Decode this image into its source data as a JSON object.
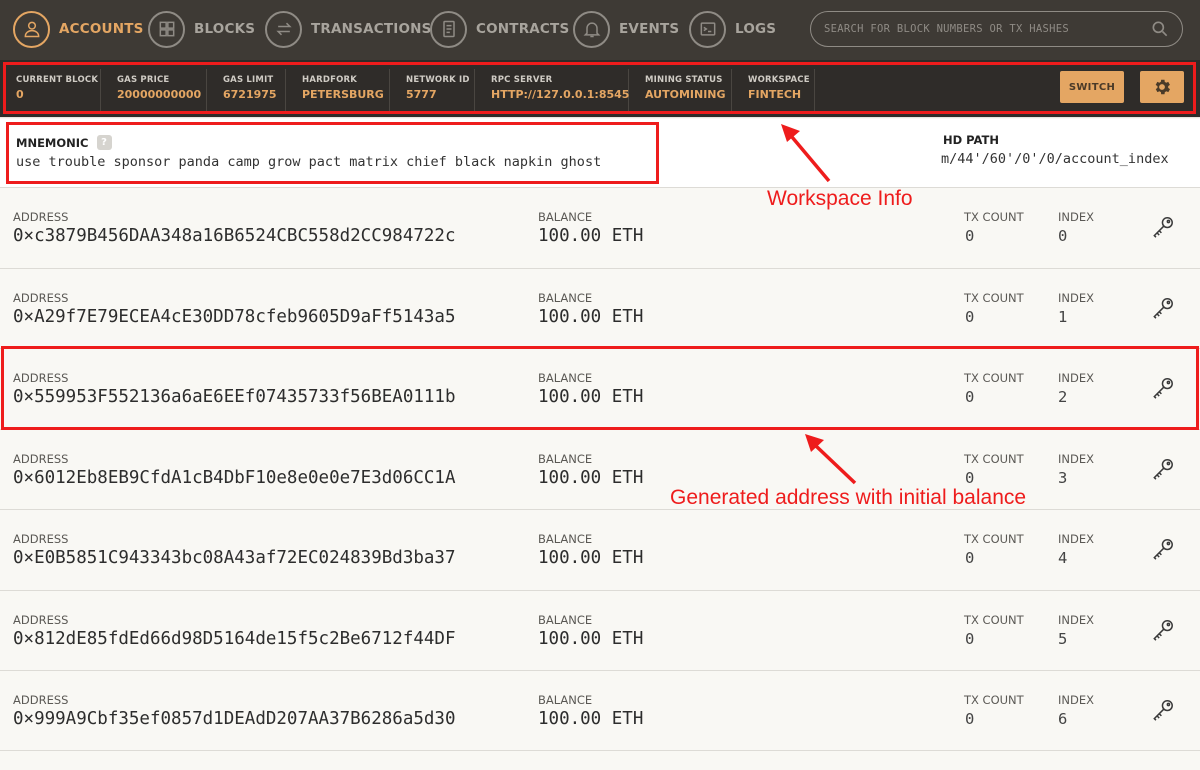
{
  "nav": {
    "items": [
      {
        "label": "ACCOUNTS",
        "icon": "person-icon",
        "active": true
      },
      {
        "label": "BLOCKS",
        "icon": "blocks-grid-icon"
      },
      {
        "label": "TRANSACTIONS",
        "icon": "transfer-arrows-icon"
      },
      {
        "label": "CONTRACTS",
        "icon": "document-icon"
      },
      {
        "label": "EVENTS",
        "icon": "bell-icon"
      },
      {
        "label": "LOGS",
        "icon": "terminal-icon"
      }
    ],
    "search_placeholder": "SEARCH FOR BLOCK NUMBERS OR TX HASHES"
  },
  "status": {
    "items": [
      {
        "label": "CURRENT BLOCK",
        "value": "0"
      },
      {
        "label": "GAS PRICE",
        "value": "20000000000"
      },
      {
        "label": "GAS LIMIT",
        "value": "6721975"
      },
      {
        "label": "HARDFORK",
        "value": "PETERSBURG"
      },
      {
        "label": "NETWORK ID",
        "value": "5777"
      },
      {
        "label": "RPC SERVER",
        "value": "HTTP://127.0.0.1:8545"
      },
      {
        "label": "MINING STATUS",
        "value": "AUTOMINING"
      },
      {
        "label": "WORKSPACE",
        "value": "FINTECH"
      }
    ],
    "switch_label": "SWITCH"
  },
  "mnemonic": {
    "label": "MNEMONIC",
    "help": "?",
    "words": "use trouble sponsor panda camp grow pact matrix chief black napkin ghost",
    "hd_path_label": "HD PATH",
    "hd_path": "m/44'/60'/0'/0/account_index"
  },
  "columns": {
    "address": "ADDRESS",
    "balance": "BALANCE",
    "tx_count": "TX COUNT",
    "index": "INDEX"
  },
  "accounts": [
    {
      "address": "0×c3879B456DAA348a16B6524CBC558d2CC984722c",
      "balance": "100.00 ETH",
      "tx_count": "0",
      "index": "0"
    },
    {
      "address": "0×A29f7E79ECEA4cE30DD78cfeb9605D9aFf5143a5",
      "balance": "100.00 ETH",
      "tx_count": "0",
      "index": "1"
    },
    {
      "address": "0×559953F552136a6aE6EEf07435733f56BEA0111b",
      "balance": "100.00 ETH",
      "tx_count": "0",
      "index": "2"
    },
    {
      "address": "0×6012Eb8EB9CfdA1cB4DbF10e8e0e0e7E3d06CC1A",
      "balance": "100.00 ETH",
      "tx_count": "0",
      "index": "3"
    },
    {
      "address": "0×E0B5851C943343bc08A43af72EC024839Bd3ba37",
      "balance": "100.00 ETH",
      "tx_count": "0",
      "index": "4"
    },
    {
      "address": "0×812dE85fdEd66d98D5164de15f5c2Be6712f44DF",
      "balance": "100.00 ETH",
      "tx_count": "0",
      "index": "5"
    },
    {
      "address": "0×999A9Cbf35ef0857d1DEAdD207AA37B6286a5d30",
      "balance": "100.00 ETH",
      "tx_count": "0",
      "index": "6"
    }
  ],
  "annotations": {
    "workspace": "Workspace Info",
    "generated": "Generated address with initial balance"
  },
  "colors": {
    "accent": "#e4a663",
    "nav_bg": "#3e3a35",
    "status_bg": "#2f2c29",
    "annotation_red": "#ee1c1c"
  }
}
